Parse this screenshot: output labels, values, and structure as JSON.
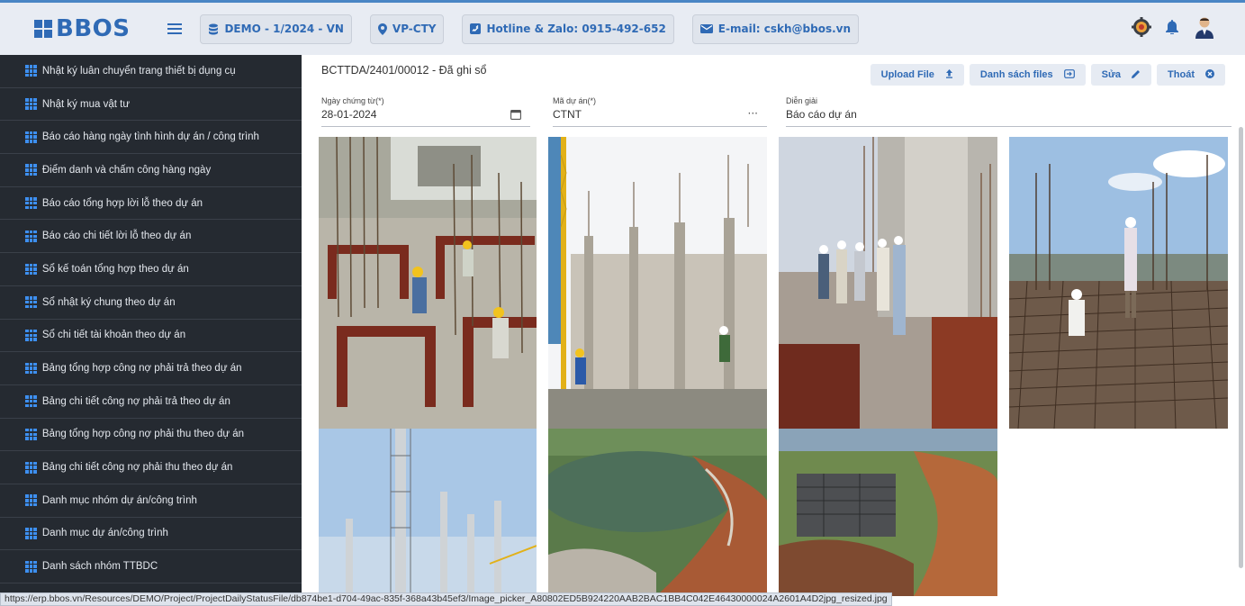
{
  "header": {
    "logo_text": "BBOS",
    "chips": [
      {
        "icon": "database-icon",
        "label": "DEMO - 1/2024 - VN"
      },
      {
        "icon": "location-pin-icon",
        "label": "VP-CTY"
      },
      {
        "icon": "phone-square-icon",
        "label": "Hotline & Zalo: 0915-492-652"
      },
      {
        "icon": "envelope-icon",
        "label": "E-mail: cskh@bbos.vn"
      }
    ]
  },
  "sidebar": {
    "items": [
      {
        "label": "Nhật ký luân chuyển trang thiết bị dụng cụ"
      },
      {
        "label": "Nhật ký mua vật tư"
      },
      {
        "label": "Báo cáo hàng ngày tình hình dự án / công trình"
      },
      {
        "label": "Điểm danh và chấm công hàng ngày"
      },
      {
        "label": "Báo cáo tổng hợp lời lỗ theo dự án"
      },
      {
        "label": "Báo cáo chi tiết lời lỗ theo dự án"
      },
      {
        "label": "Sổ kế toán tổng hợp theo dự án"
      },
      {
        "label": "Sổ nhật ký chung theo dự án"
      },
      {
        "label": "Sổ chi tiết tài khoản theo dự án"
      },
      {
        "label": "Bảng tổng hợp công nợ phải trả theo dự án"
      },
      {
        "label": "Bảng chi tiết công nợ phải trả theo dự án"
      },
      {
        "label": "Bảng tổng hợp công nợ phải thu theo dự án"
      },
      {
        "label": "Bảng chi tiết công nợ phải thu theo dự án"
      },
      {
        "label": "Danh mục nhóm dự án/công trình"
      },
      {
        "label": "Danh mục dự án/công trình"
      },
      {
        "label": "Danh sách nhóm TTBDC"
      }
    ]
  },
  "main": {
    "doc_title": "BCTTDA/2401/00012 - Đã ghi sổ",
    "actions": [
      {
        "label": "Upload File",
        "icon": "upload-icon"
      },
      {
        "label": "Danh sách files",
        "icon": "file-list-icon"
      },
      {
        "label": "Sửa",
        "icon": "pencil-icon"
      },
      {
        "label": "Thoát",
        "icon": "close-circle-icon"
      }
    ],
    "fields": {
      "date": {
        "label": "Ngày chứng từ(*)",
        "value": "28-01-2024"
      },
      "project": {
        "label": "Mã dự án(*)",
        "value": "CTNT"
      },
      "desc": {
        "label": "Diễn giải",
        "value": "Báo cáo dự án"
      }
    },
    "photos": [
      {
        "name": "photo-rebar-workers"
      },
      {
        "name": "photo-concrete-columns"
      },
      {
        "name": "photo-site-inspection"
      },
      {
        "name": "photo-rebar-deck"
      },
      {
        "name": "photo-column-towers"
      },
      {
        "name": "photo-aerial-lake"
      },
      {
        "name": "photo-aerial-site"
      }
    ]
  },
  "status_url": "https://erp.bbos.vn/Resources/DEMO/Project/ProjectDailyStatusFile/db874be1-d704-49ac-835f-368a43b45ef3/Image_picker_A80802ED5B924220AAB2BAC1BB4C042E46430000024A2601A4D2jpg_resized.jpg",
  "colors": {
    "brand": "#2f6ab5",
    "sidebar_bg": "#252a31",
    "sidebar_icon": "#3d8ff0",
    "header_bg": "#e8ecf3"
  }
}
